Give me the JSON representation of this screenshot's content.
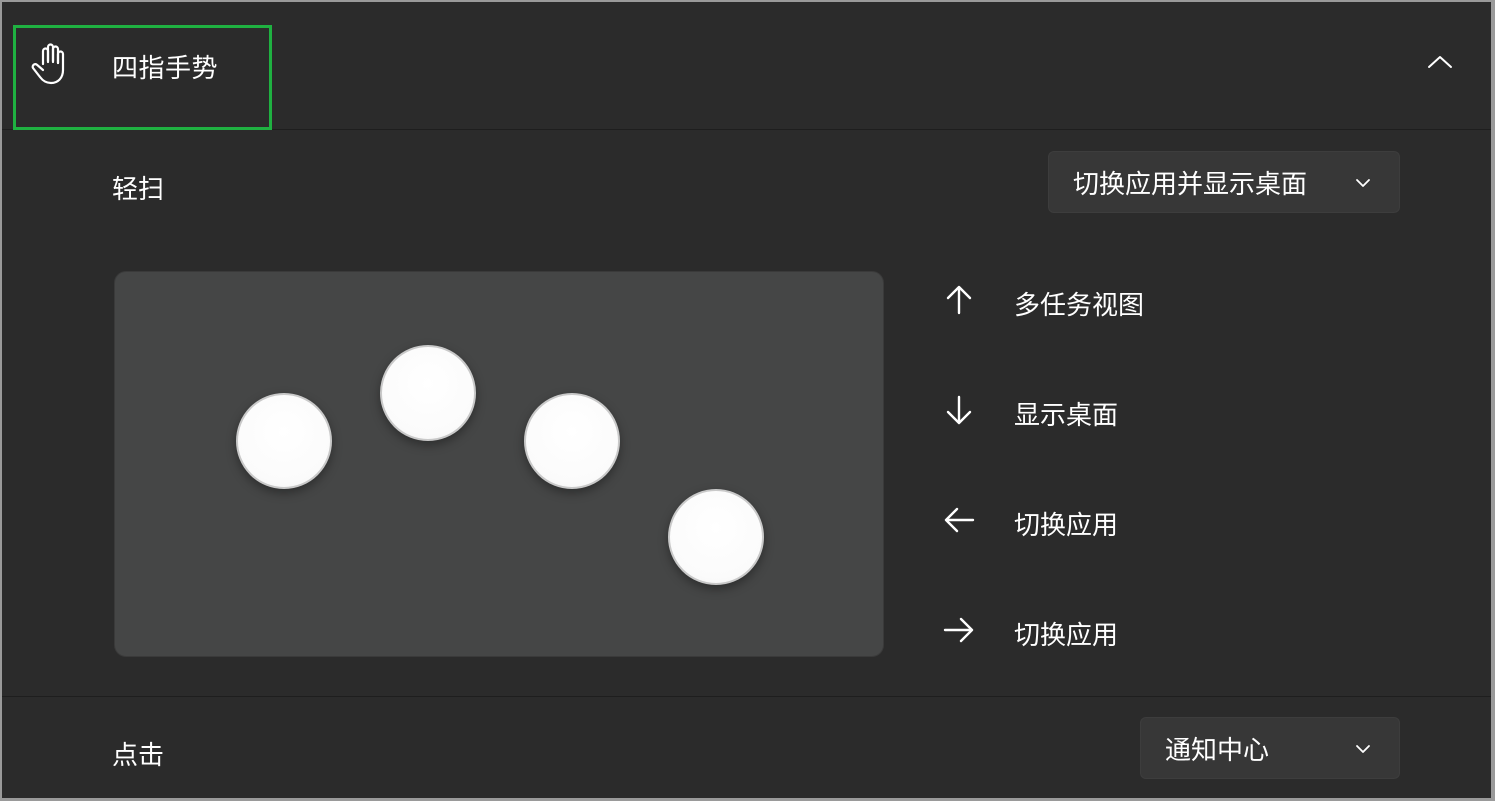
{
  "header": {
    "title": "四指手势",
    "icon": "hand-icon",
    "collapse_icon": "chevron-up-icon"
  },
  "swipe": {
    "label": "轻扫",
    "selected": "切换应用并显示桌面"
  },
  "gestures": [
    {
      "direction": "up",
      "icon": "arrow-up-icon",
      "label": "多任务视图"
    },
    {
      "direction": "down",
      "icon": "arrow-down-icon",
      "label": "显示桌面"
    },
    {
      "direction": "left",
      "icon": "arrow-left-icon",
      "label": "切换应用"
    },
    {
      "direction": "right",
      "icon": "arrow-right-icon",
      "label": "切换应用"
    }
  ],
  "tap": {
    "label": "点击",
    "selected": "通知中心"
  },
  "colors": {
    "background": "#2b2b2b",
    "touchpad": "#454646",
    "highlight": "#1fb141",
    "text": "#ffffff"
  }
}
